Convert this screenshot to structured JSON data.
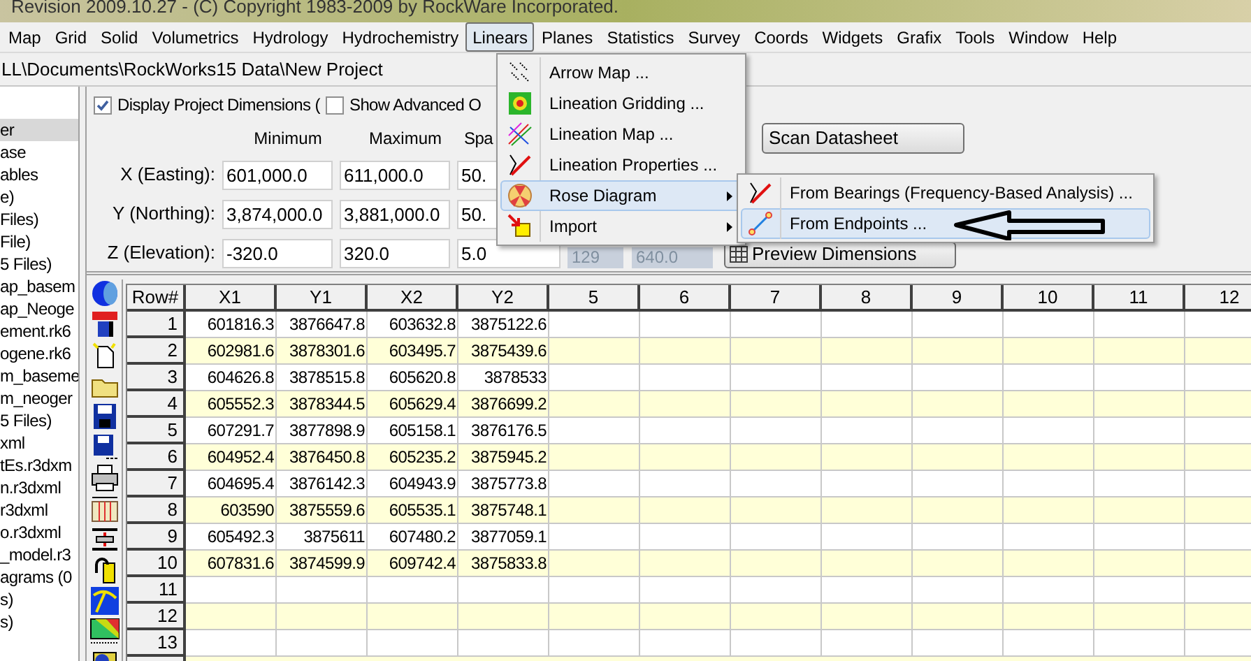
{
  "title_bar": {
    "text": "Revision 2009.10.27 - (C) Copyright 1983-2009 by RockWare Incorporated."
  },
  "menu_bar": [
    {
      "label": "Map",
      "selected": false
    },
    {
      "label": "Grid",
      "selected": false
    },
    {
      "label": "Solid",
      "selected": false
    },
    {
      "label": "Volumetrics",
      "selected": false
    },
    {
      "label": "Hydrology",
      "selected": false
    },
    {
      "label": "Hydrochemistry",
      "selected": false
    },
    {
      "label": "Linears",
      "selected": true
    },
    {
      "label": "Planes",
      "selected": false
    },
    {
      "label": "Statistics",
      "selected": false
    },
    {
      "label": "Survey",
      "selected": false
    },
    {
      "label": "Coords",
      "selected": false
    },
    {
      "label": "Widgets",
      "selected": false
    },
    {
      "label": "Grafix",
      "selected": false
    },
    {
      "label": "Tools",
      "selected": false
    },
    {
      "label": "Window",
      "selected": false
    },
    {
      "label": "Help",
      "selected": false
    }
  ],
  "path": "LL\\Documents\\RockWorks15 Data\\New Project",
  "sidebar": {
    "items": [
      {
        "label": "er",
        "selected": true
      },
      {
        "label": "ase",
        "selected": false
      },
      {
        "label": "ables",
        "selected": false
      },
      {
        "label": "e)",
        "selected": false
      },
      {
        "label": "Files)",
        "selected": false
      },
      {
        "label": "File)",
        "selected": false
      },
      {
        "label": "5 Files)",
        "selected": false
      },
      {
        "label": "ap_basem",
        "selected": false
      },
      {
        "label": "ap_Neoge",
        "selected": false
      },
      {
        "label": "ement.rk6",
        "selected": false
      },
      {
        "label": "ogene.rk6",
        "selected": false
      },
      {
        "label": "m_baseme",
        "selected": false
      },
      {
        "label": "m_neoger",
        "selected": false
      },
      {
        "label": "5 Files)",
        "selected": false
      },
      {
        "label": "xml",
        "selected": false
      },
      {
        "label": "tEs.r3dxm",
        "selected": false
      },
      {
        "label": "n.r3dxml",
        "selected": false
      },
      {
        "label": "r3dxml",
        "selected": false
      },
      {
        "label": "o.r3dxml",
        "selected": false
      },
      {
        "label": "_model.r3",
        "selected": false
      },
      {
        "label": "agrams (0",
        "selected": false
      },
      {
        "label": "s)",
        "selected": false
      },
      {
        "label": "s)",
        "selected": false
      }
    ]
  },
  "project_panel": {
    "display_dimensions": {
      "label": "Display Project Dimensions (",
      "checked": true
    },
    "show_advanced": {
      "label": "Show Advanced O",
      "checked": false
    },
    "headings": [
      "Minimum",
      "Maximum",
      "Spa"
    ],
    "rows": [
      {
        "label": "X (Easting):",
        "min": "601,000.0",
        "max": "611,000.0",
        "spacing": "50."
      },
      {
        "label": "Y (Northing):",
        "min": "3,874,000.0",
        "max": "3,881,000.0",
        "spacing": "50."
      },
      {
        "label": "Z (Elevation):",
        "min": "-320.0",
        "max": "320.0",
        "spacing": "5.0"
      }
    ],
    "extra_fields": [
      "129",
      "640.0"
    ],
    "scan_button": "Scan Datasheet",
    "preview_button": "Preview Dimensions"
  },
  "grid": {
    "columns": [
      "Row#",
      "X1",
      "Y1",
      "X2",
      "Y2",
      "5",
      "6",
      "7",
      "8",
      "9",
      "10",
      "11",
      "12"
    ],
    "rows": [
      [
        "1",
        "601816.3",
        "3876647.8",
        "603632.8",
        "3875122.6"
      ],
      [
        "2",
        "602981.6",
        "3878301.6",
        "603495.7",
        "3875439.6"
      ],
      [
        "3",
        "604626.8",
        "3878515.8",
        "605620.8",
        "3878533"
      ],
      [
        "4",
        "605552.3",
        "3878344.5",
        "605629.4",
        "3876699.2"
      ],
      [
        "5",
        "607291.7",
        "3877898.9",
        "605158.1",
        "3876176.5"
      ],
      [
        "6",
        "604952.4",
        "3876450.8",
        "605235.2",
        "3875945.2"
      ],
      [
        "7",
        "604695.4",
        "3876142.3",
        "604943.9",
        "3875773.8"
      ],
      [
        "8",
        "603590",
        "3875559.6",
        "605535.1",
        "3875748.1"
      ],
      [
        "9",
        "605492.3",
        "3875611",
        "607480.2",
        "3877059.1"
      ],
      [
        "10",
        "607831.6",
        "3874599.9",
        "609742.4",
        "3875833.8"
      ],
      [
        "11"
      ],
      [
        "12"
      ],
      [
        "13"
      ]
    ]
  },
  "linears_menu": {
    "items": [
      {
        "label": "Arrow Map ...",
        "kind": "action",
        "highlighted": false
      },
      {
        "label": "Lineation Gridding ...",
        "kind": "action",
        "highlighted": false
      },
      {
        "label": "Lineation Map ...",
        "kind": "action",
        "highlighted": false
      },
      {
        "label": "Lineation Properties ...",
        "kind": "action",
        "highlighted": false
      },
      {
        "label": "Rose Diagram",
        "kind": "submenu",
        "highlighted": true
      },
      {
        "label": "Import",
        "kind": "submenu",
        "highlighted": false
      }
    ]
  },
  "rose_submenu": {
    "items": [
      {
        "label": "From Bearings (Frequency-Based Analysis) ...",
        "highlighted": false
      },
      {
        "label": "From Endpoints ...",
        "highlighted": true
      }
    ]
  }
}
